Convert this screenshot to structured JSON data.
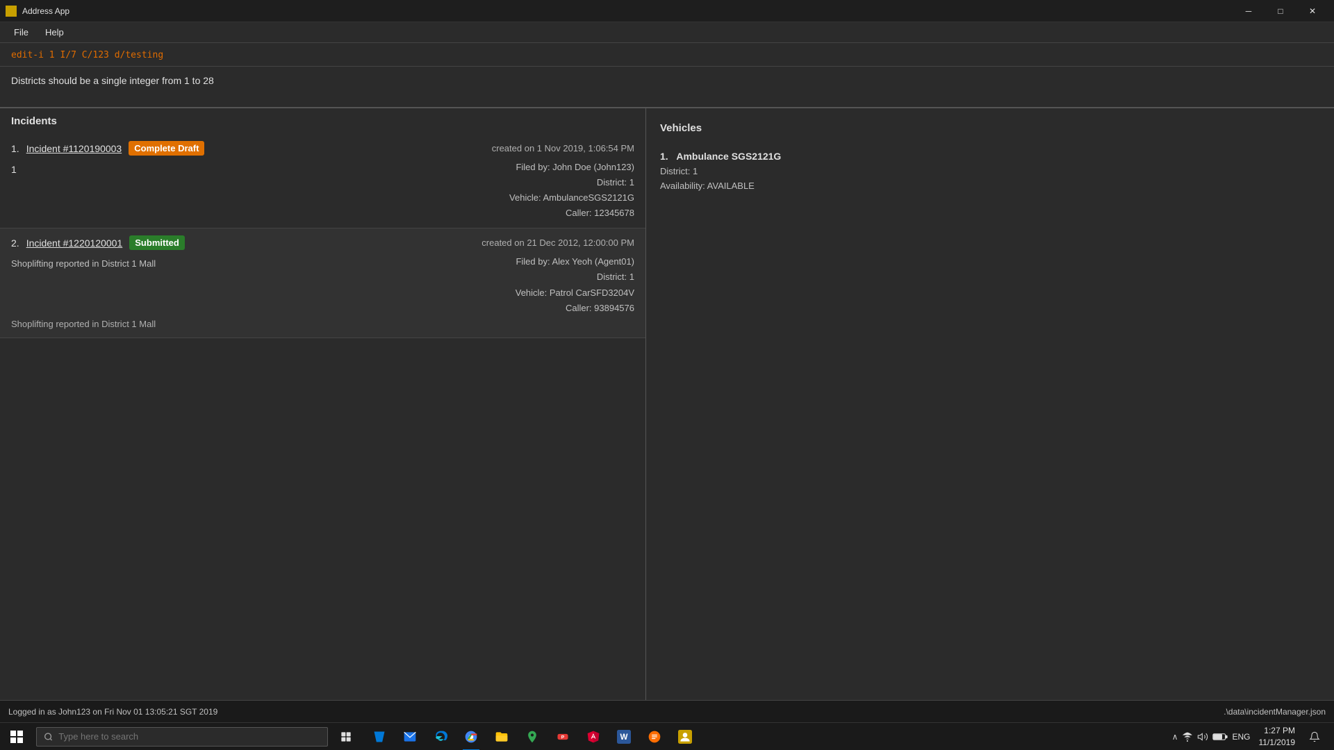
{
  "titleBar": {
    "title": "Address App",
    "minimize": "─",
    "maximize": "□",
    "close": "✕"
  },
  "menuBar": {
    "items": [
      "File",
      "Help"
    ]
  },
  "command": {
    "text": "edit-i 1 I/7 C/123 d/testing"
  },
  "validation": {
    "message": "Districts should be a single integer from 1 to 28"
  },
  "incidentsPanel": {
    "header": "Incidents",
    "incidents": [
      {
        "number": "1.",
        "id": "Incident #1120190003",
        "badge": "Complete Draft",
        "badgeType": "draft",
        "created": "created on 1 Nov 2019, 1:06:54 PM",
        "district": "1",
        "filedBy": "Filed by: John Doe (John123)",
        "districtLabel": "District: 1",
        "vehicle": "Vehicle: AmbulanceSGS2121G",
        "caller": "Caller: 12345678",
        "description": ""
      },
      {
        "number": "2.",
        "id": "Incident #1220120001",
        "badge": "Submitted",
        "badgeType": "submitted",
        "created": "created on 21 Dec 2012, 12:00:00 PM",
        "district": "",
        "filedBy": "Filed by: Alex Yeoh (Agent01)",
        "districtLabel": "District: 1",
        "vehicle": "Vehicle: Patrol CarSFD3204V",
        "caller": "Caller: 93894576",
        "description": "Shoplifting reported in District 1 Mall"
      }
    ]
  },
  "vehiclesPanel": {
    "header": "Vehicles",
    "vehicles": [
      {
        "number": "1.",
        "name": "Ambulance SGS2121G",
        "district": "District: 1",
        "availability": "Availability: AVAILABLE"
      }
    ]
  },
  "statusBar": {
    "left": "Logged in as John123 on Fri Nov 01 13:05:21 SGT 2019",
    "right": ".\\data\\incidentManager.json"
  },
  "taskbar": {
    "search": {
      "placeholder": "Type here to search"
    },
    "clock": {
      "time": "1:27 PM",
      "date": "11/1/2019"
    },
    "language": "ENG"
  }
}
